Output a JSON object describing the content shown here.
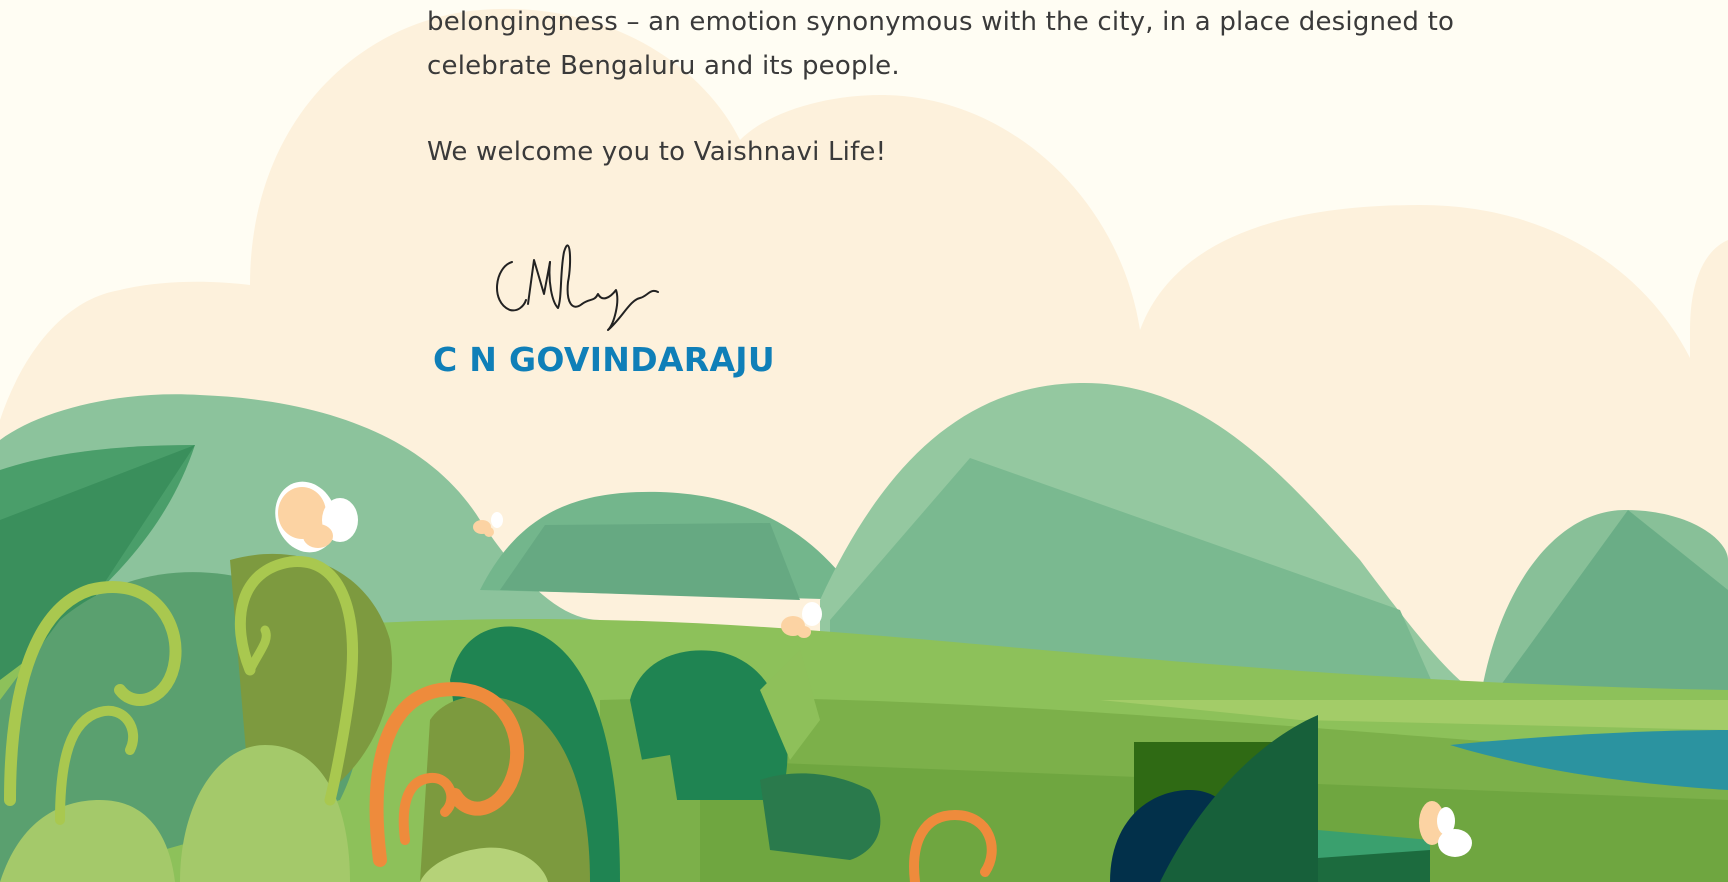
{
  "letter": {
    "paragraph_end_line1": "belongingness – an emotion synonymous with the city, in a place designed to",
    "paragraph_end_line2": "celebrate Bengaluru and its people.",
    "welcome": "We welcome you to Vaishnavi Life!"
  },
  "signature": {
    "signatory_name": "C N GOVINDARAJU",
    "signature_text": "CNG"
  },
  "colors": {
    "background": "#fffdf3",
    "cloud": "#fdf1dc",
    "hill_light": "#8cc39c",
    "hill_dark": "#66a982",
    "grass": "#8dc15a",
    "leaf_dark": "#1f8452",
    "fern_orange": "#ee8b3c",
    "fern_lime": "#a9c84f",
    "water": "#2b93a0",
    "name_blue": "#0f7fb8"
  },
  "icons": [
    "butterfly-icon",
    "signature-icon"
  ]
}
